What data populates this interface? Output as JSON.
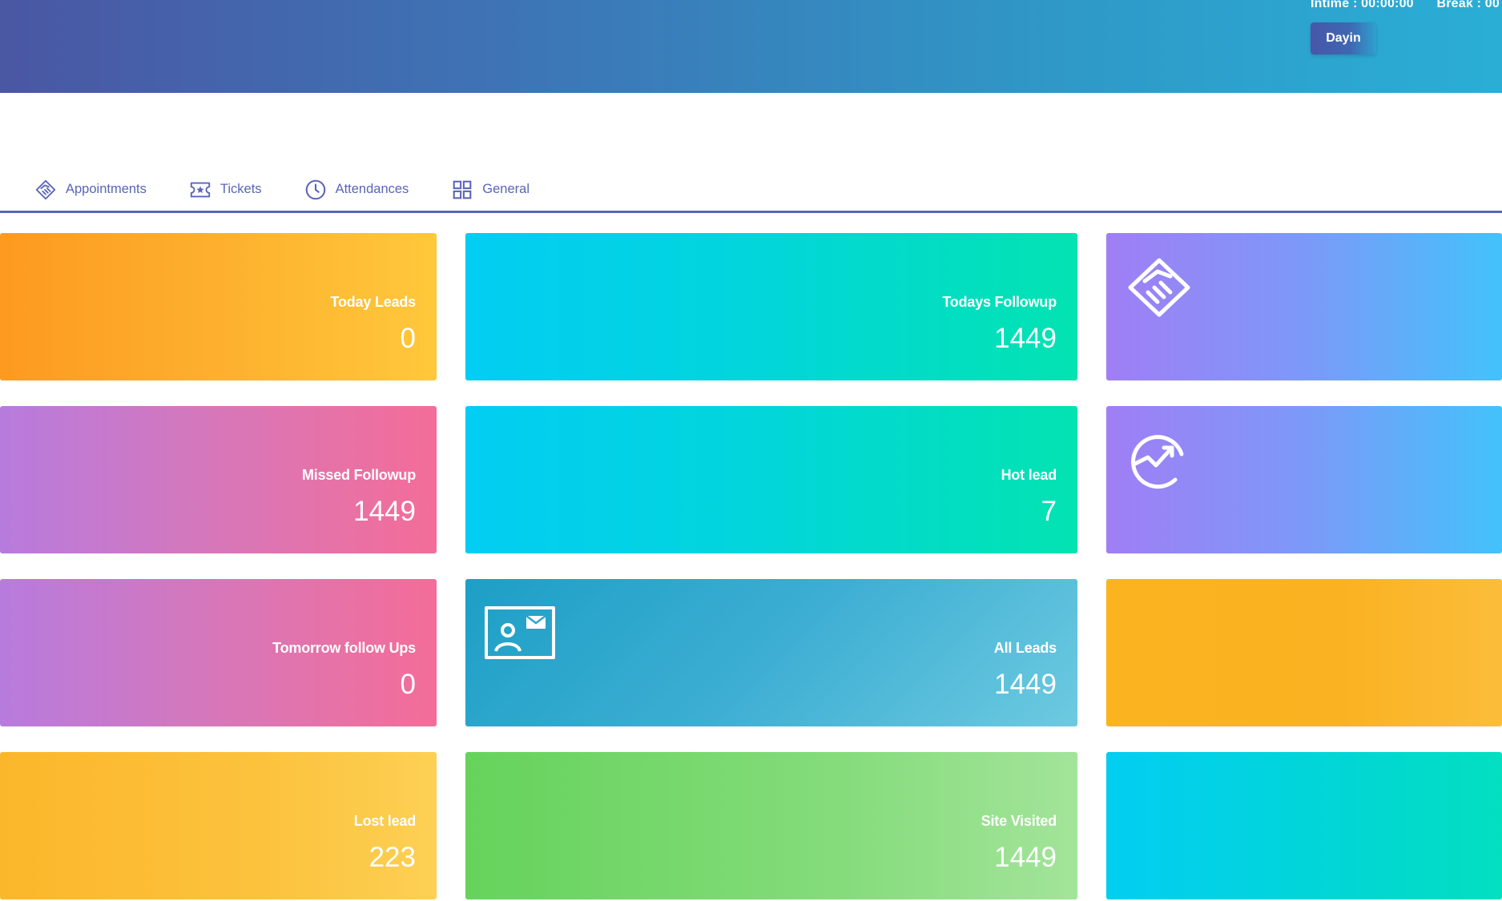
{
  "header": {
    "intime": "Intime : 00:00:00",
    "break": "Break : 00",
    "dayin_label": "Dayin"
  },
  "tabs": [
    {
      "label": "Appointments",
      "icon": "handshake-icon"
    },
    {
      "label": "Tickets",
      "icon": "ticket-icon"
    },
    {
      "label": "Attendances",
      "icon": "clock-icon"
    },
    {
      "label": "General",
      "icon": "grid-icon"
    }
  ],
  "cards": {
    "today_leads": {
      "label": "Today Leads",
      "value": "0",
      "color": "#fdb02e"
    },
    "todays_followup": {
      "label": "Todays Followup",
      "value": "1449",
      "color": "#02d6d9"
    },
    "missed_followup": {
      "label": "Missed Followup",
      "value": "1449",
      "color": "#d777b9"
    },
    "hot_lead": {
      "label": "Hot lead",
      "value": "7",
      "color": "#02d6d9"
    },
    "tomorrow_followups": {
      "label": "Tomorrow follow Ups",
      "value": "0",
      "color": "#d777b9"
    },
    "all_leads": {
      "label": "All Leads",
      "value": "1449",
      "color": "#3daed3",
      "icon": "contact-card-icon"
    },
    "lost_lead": {
      "label": "Lost lead",
      "value": "223",
      "color": "#fcc23d"
    },
    "site_visited": {
      "label": "Site Visited",
      "value": "1449",
      "color": "#84dc7a"
    },
    "right_cards": [
      {
        "icon": "handshake-icon",
        "color": "#7c99f8"
      },
      {
        "icon": "growth-chart-icon",
        "color": "#7c99f8"
      },
      {
        "color": "#fbb222"
      },
      {
        "color": "#02d6d5"
      }
    ]
  }
}
